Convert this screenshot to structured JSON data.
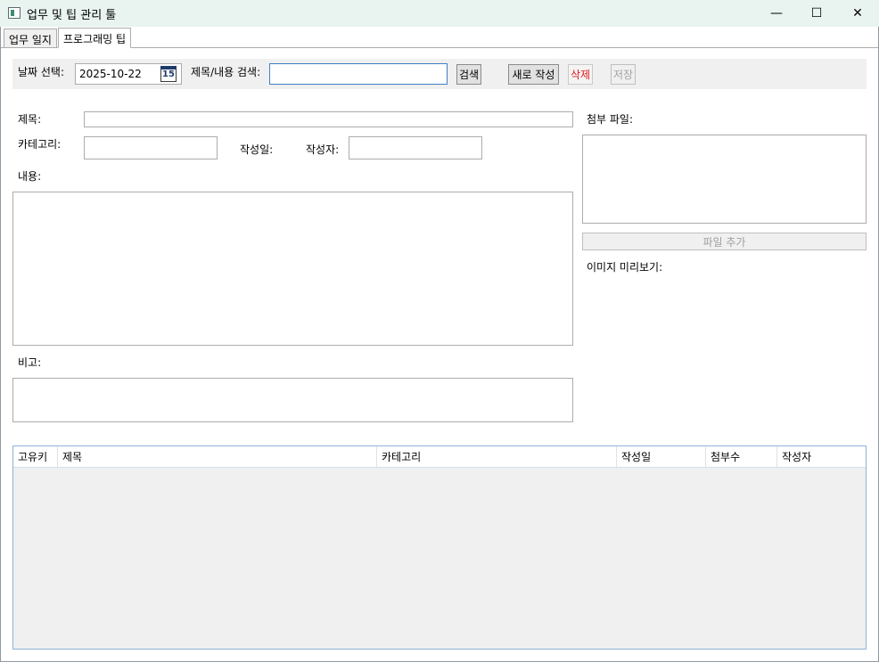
{
  "window": {
    "title": "업무 및 팁 관리 툴",
    "minimize": "—",
    "maximize": "☐",
    "close": "✕"
  },
  "tabs": [
    {
      "label": "업무 일지"
    },
    {
      "label": "프로그래밍 팁"
    }
  ],
  "toolbar": {
    "date_label": "날짜 선택:",
    "date_value": "2025-10-22",
    "calendar_day": "15",
    "search_label": "제목/내용 검색:",
    "search_value": "",
    "search_button": "검색",
    "new_button": "새로 작성",
    "delete_button": "삭제",
    "save_button": "저장"
  },
  "form": {
    "title_label": "제목:",
    "title_value": "",
    "category_label": "카테고리:",
    "category_value": "",
    "created_label": "작성일:",
    "author_label": "작성자:",
    "author_value": "",
    "content_label": "내용:",
    "content_value": "",
    "note_label": "비고:",
    "note_value": ""
  },
  "attachments": {
    "label": "첨부 파일:",
    "add_button": "파일 추가",
    "preview_label": "이미지 미리보기:"
  },
  "grid": {
    "columns": [
      "고유키",
      "제목",
      "카테고리",
      "작성일",
      "첨부수",
      "작성자"
    ],
    "rows": []
  }
}
